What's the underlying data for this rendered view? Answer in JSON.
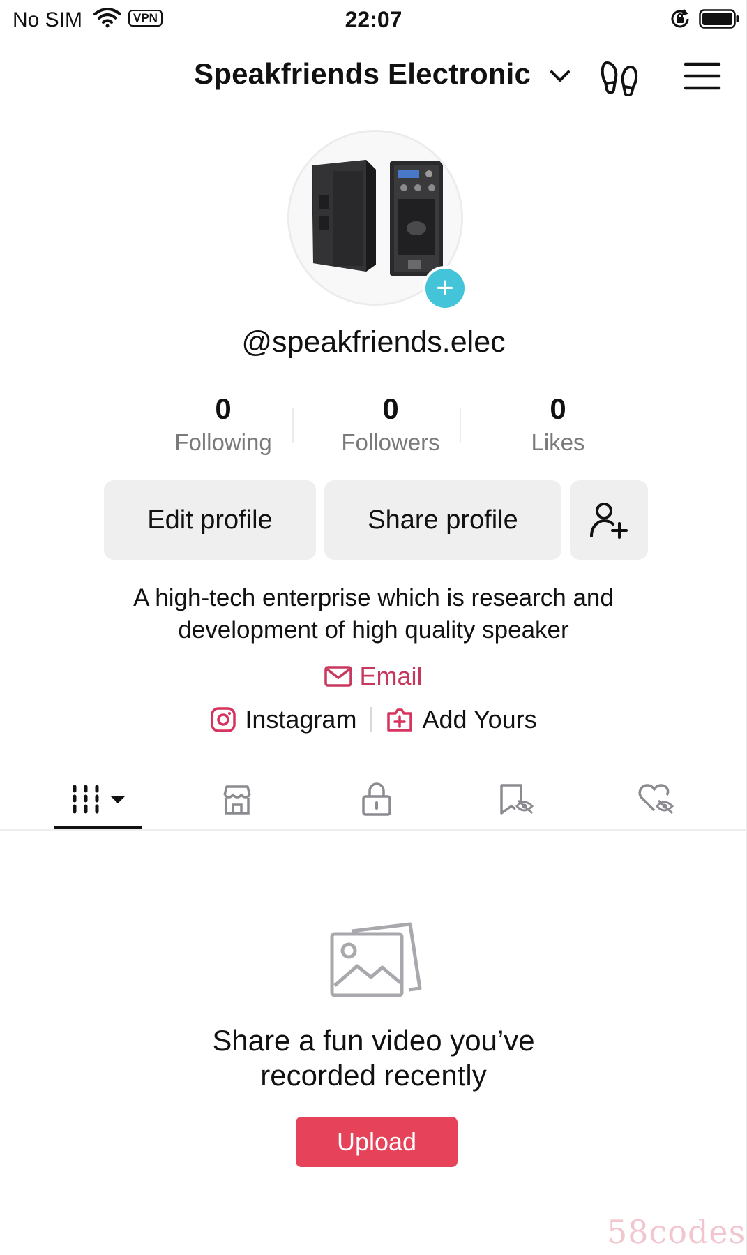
{
  "status_bar": {
    "carrier": "No SIM",
    "vpn": "VPN",
    "time": "22:07"
  },
  "header": {
    "title": "Speakfriends Electronic"
  },
  "profile": {
    "username": "@speakfriends.elec",
    "stats": [
      {
        "count": "0",
        "label": "Following"
      },
      {
        "count": "0",
        "label": "Followers"
      },
      {
        "count": "0",
        "label": "Likes"
      }
    ],
    "edit_label": "Edit profile",
    "share_label": "Share profile",
    "bio_line1": "A high-tech enterprise which is research and",
    "bio_line2": "development of high quality speaker",
    "email_label": "Email",
    "instagram_label": "Instagram",
    "add_yours_label": "Add Yours"
  },
  "tabs": [
    "videos-grid-icon",
    "shop-icon",
    "private-lock-icon",
    "saved-hidden-icon",
    "liked-hidden-icon"
  ],
  "empty_state": {
    "title_line1": "Share a fun video you’ve",
    "title_line2": "recorded recently",
    "upload_label": "Upload"
  },
  "watermark": "58codes",
  "colors": {
    "accent_red": "#e6435a",
    "email_pink": "#c8375d",
    "avatar_plus": "#43c4d8"
  }
}
